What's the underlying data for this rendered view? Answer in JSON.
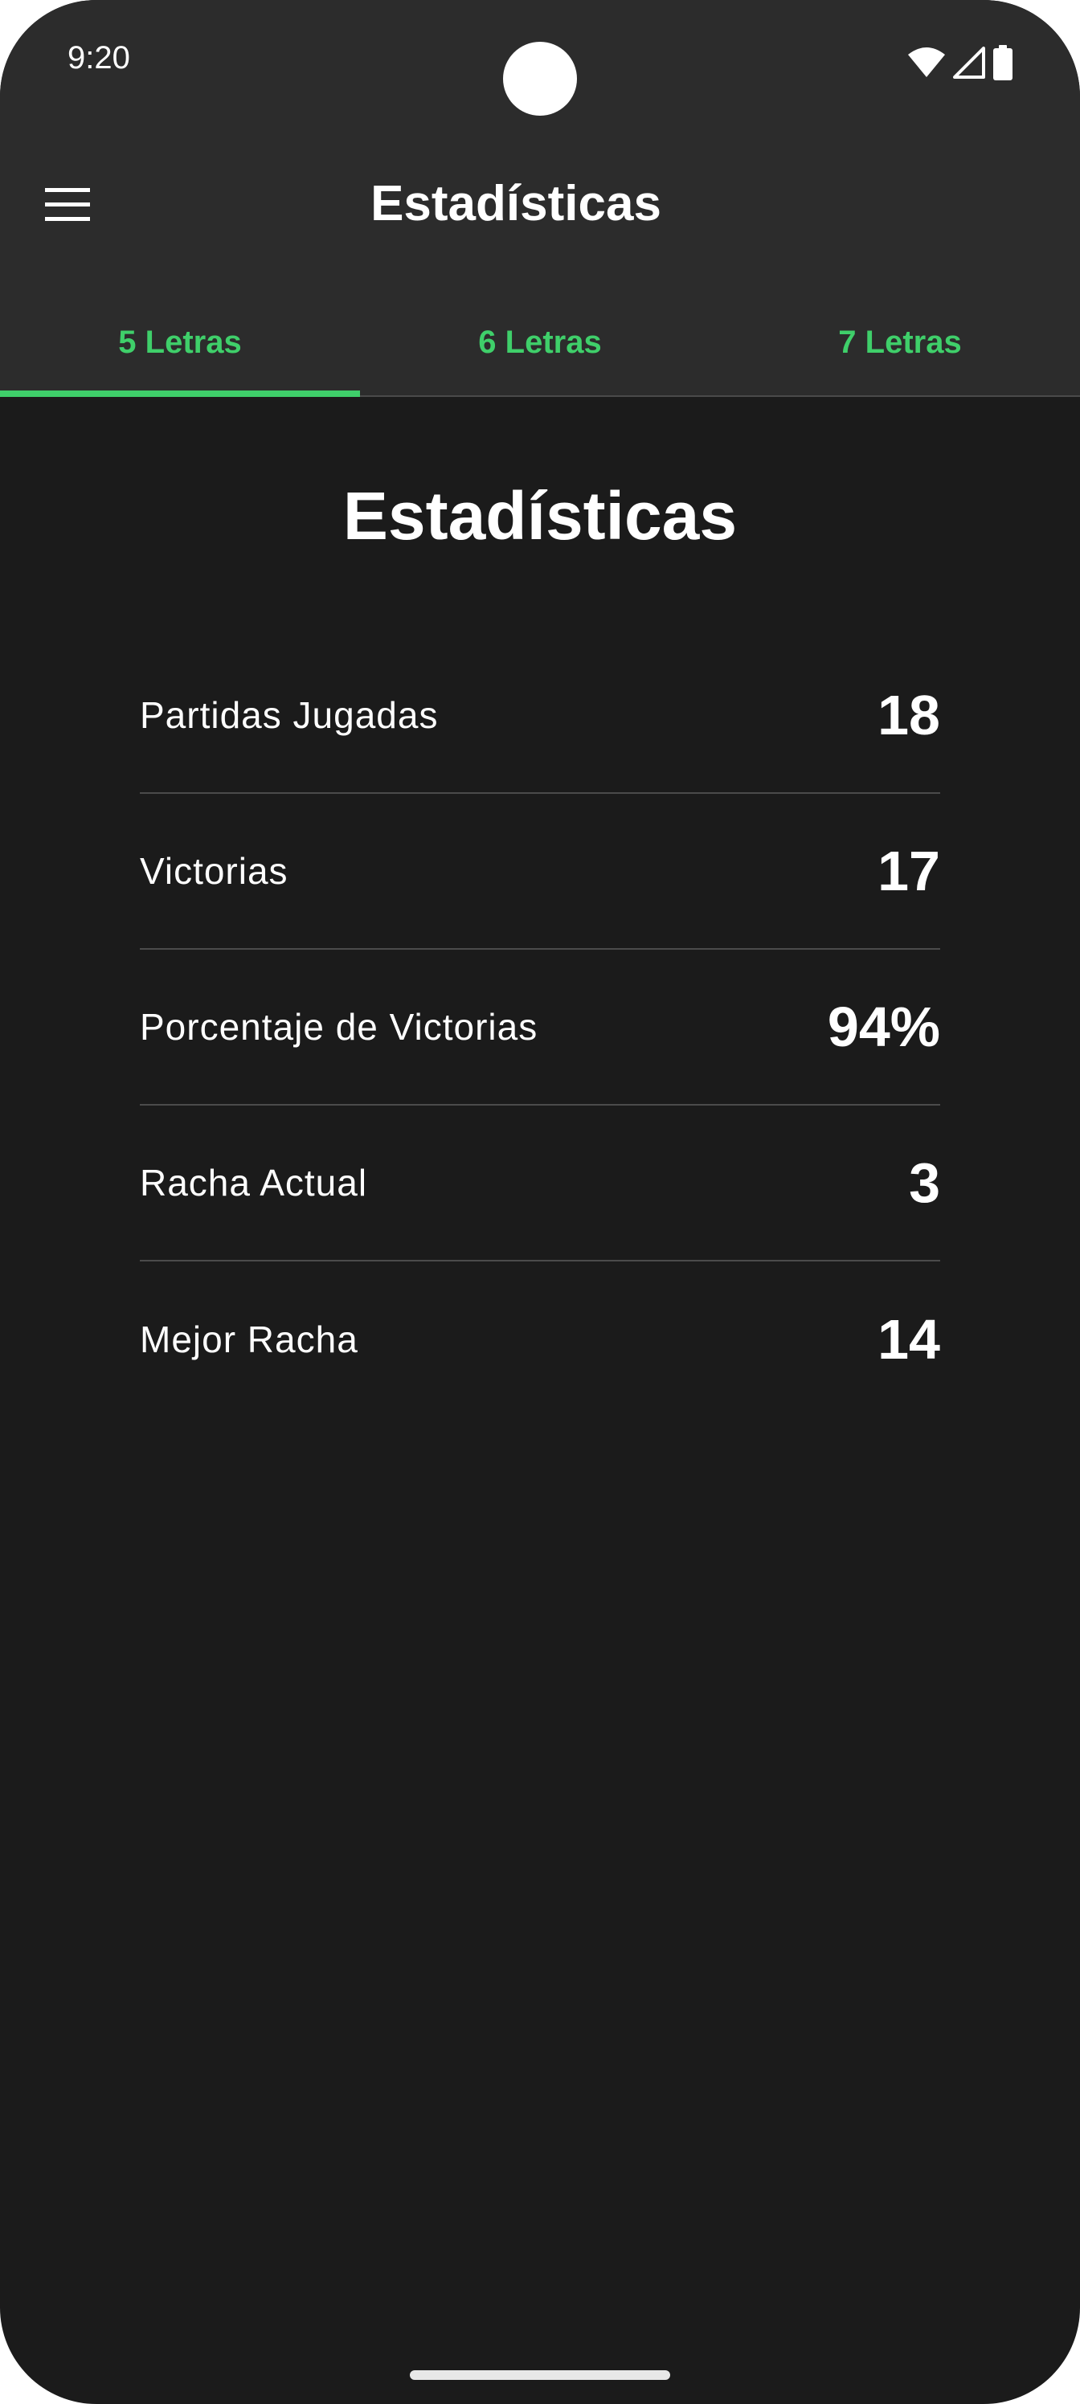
{
  "status_bar": {
    "time": "9:20",
    "icons": [
      "wifi-icon",
      "signal-icon",
      "battery-icon"
    ]
  },
  "app_bar": {
    "title": "Estadísticas",
    "menu_icon": "hamburger-menu-icon"
  },
  "tabs": [
    {
      "label": "5 Letras",
      "active": true
    },
    {
      "label": "6 Letras",
      "active": false
    },
    {
      "label": "7 Letras",
      "active": false
    }
  ],
  "content": {
    "title": "Estadísticas",
    "stats": [
      {
        "label": "Partidas Jugadas",
        "value": "18"
      },
      {
        "label": "Victorias",
        "value": "17"
      },
      {
        "label": "Porcentaje de Victorias",
        "value": "94%"
      },
      {
        "label": "Racha Actual",
        "value": "3"
      },
      {
        "label": "Mejor Racha",
        "value": "14"
      }
    ]
  },
  "colors": {
    "accent": "#3fcf6a",
    "background": "#1b1b1b",
    "surface": "#2c2c2c",
    "text": "#ffffff",
    "divider": "#4b4b4b"
  }
}
